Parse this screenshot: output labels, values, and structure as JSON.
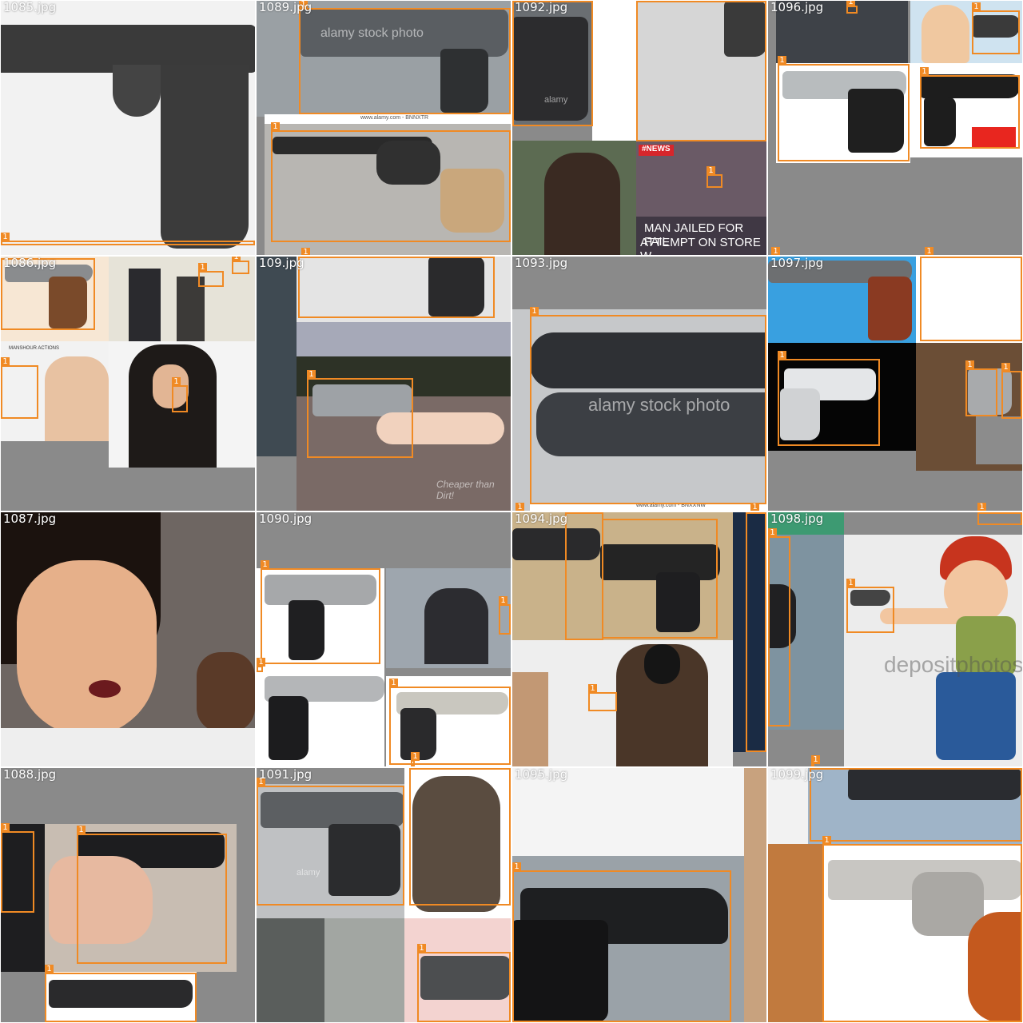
{
  "colors": {
    "box": "#f08a24",
    "label_text": "#ffffff",
    "filename_text": "#ffffff",
    "padding": "#8a8a8a"
  },
  "box_label": "1",
  "tiles": [
    {
      "filename": "1085.jpg"
    },
    {
      "filename": "1089.jpg",
      "watermarks": [
        "alamy stock photo",
        "www.alamy.com - BNNXTR"
      ]
    },
    {
      "filename": "1092.jpg",
      "caption_lines": [
        "MAN JAILED FOR FAIL",
        "ATTEMPT ON STORE W"
      ],
      "badge": "#NEWS",
      "watermark": "alamy"
    },
    {
      "filename": "1096.jpg"
    },
    {
      "filename": "1086.jpg",
      "banner": "MANSHOUR ACTIONS"
    },
    {
      "filename": "109.jpg",
      "watermark": "Cheaper than Dirt!"
    },
    {
      "filename": "1093.jpg",
      "watermarks": [
        "alamy stock photo",
        "www.alamy.com - BNXXNW"
      ]
    },
    {
      "filename": "1097.jpg"
    },
    {
      "filename": "1087.jpg"
    },
    {
      "filename": "1090.jpg"
    },
    {
      "filename": "1094.jpg"
    },
    {
      "filename": "1098.jpg",
      "watermark": "depositphotos"
    },
    {
      "filename": "1088.jpg"
    },
    {
      "filename": "1091.jpg",
      "watermark": "alamy"
    },
    {
      "filename": "1095.jpg"
    },
    {
      "filename": "1099.jpg"
    }
  ]
}
